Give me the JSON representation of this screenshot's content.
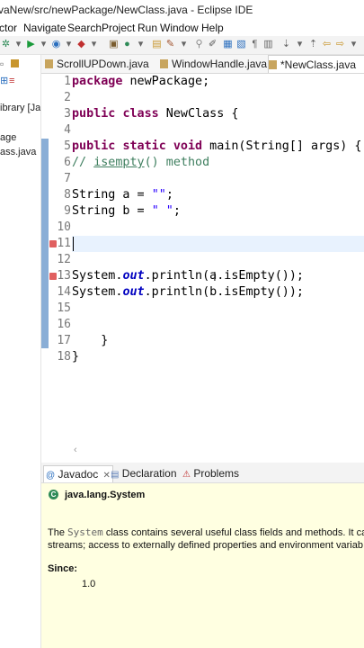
{
  "window": {
    "title": "vaNew/src/newPackage/NewClass.java - Eclipse IDE"
  },
  "menu": [
    "ctor",
    "Navigate",
    "Search",
    "Project",
    "Run",
    "Window",
    "Help"
  ],
  "left_panel": {
    "items": [
      "ibrary [Ja",
      "age",
      "ass.java"
    ]
  },
  "editor_tabs": [
    {
      "label": "ScrollUPDown.java"
    },
    {
      "label": "WindowHandle.java"
    },
    {
      "label": "*NewClass.java"
    }
  ],
  "code": {
    "line_numbers": [
      "1",
      "2",
      "3",
      "4",
      "5",
      "6",
      "7",
      "8",
      "9",
      "10",
      "11",
      "12",
      "13",
      "14",
      "15",
      "16",
      "17",
      "18"
    ],
    "line1": {
      "kw": "package",
      "rest": " newPackage;"
    },
    "line3": {
      "kw1": "public",
      "kw2": "class",
      "rest": " NewClass {"
    },
    "line5": {
      "kw1": "public",
      "kw2": "static",
      "kw3": "void",
      "rest": " main(String[] args) {"
    },
    "line6": {
      "prefix": "// ",
      "underlined": "isempty",
      "rest": "() method"
    },
    "line8": {
      "pre": "String a = ",
      "str": "\"\"",
      "post": ";"
    },
    "line9": {
      "pre": "String b = ",
      "str": "\" \"",
      "post": ";"
    },
    "line13": {
      "pre": "System.",
      "fld": "out",
      "post": ".println(a.isEmpty());"
    },
    "line14": {
      "pre": "System.",
      "fld": "out",
      "post": ".println(b.isEmpty());"
    },
    "line17": "    }",
    "line18": "}"
  },
  "bottom_tabs": [
    {
      "label": "Javadoc"
    },
    {
      "label": "Declaration"
    },
    {
      "label": "Problems"
    }
  ],
  "javadoc": {
    "class_name": "java.lang.System",
    "desc1_pre": "The ",
    "desc1_code": "System",
    "desc1_post": " class contains several useful class fields and methods. It ca",
    "desc2": "streams; access to externally defined properties and environment variab",
    "since_label": "Since:",
    "since_value": "1.0"
  },
  "colors": {
    "keyword": "#7f0055",
    "string": "#2a00ff",
    "comment": "#3f7f5f",
    "field": "#0000c0",
    "ruler": "#8aaed6",
    "javadoc_bg": "#ffffe1"
  }
}
